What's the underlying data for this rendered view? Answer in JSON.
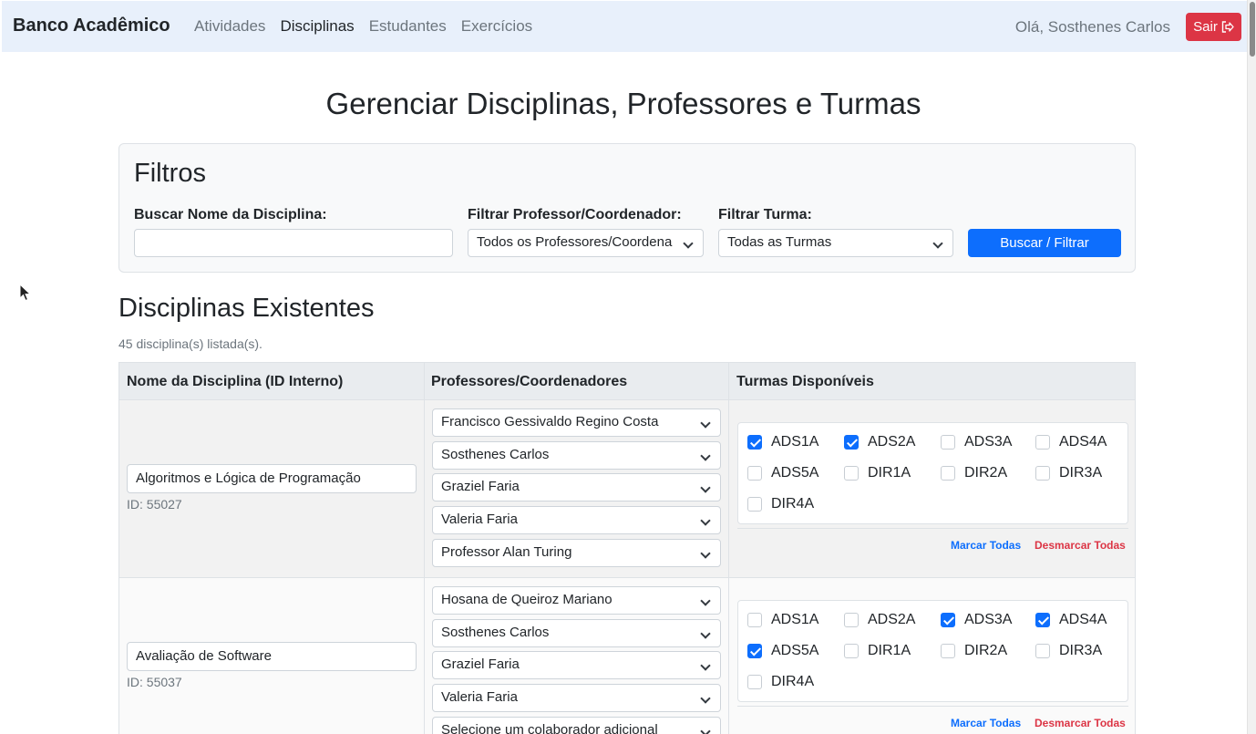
{
  "nav": {
    "brand": "Banco Acadêmico",
    "links": [
      "Atividades",
      "Disciplinas",
      "Estudantes",
      "Exercícios"
    ],
    "greeting": "Olá, Sosthenes Carlos",
    "logout": "Sair"
  },
  "page_title": "Gerenciar Disciplinas, Professores e Turmas",
  "filters": {
    "title": "Filtros",
    "name_label": "Buscar Nome da Disciplina:",
    "name_value": "",
    "prof_label": "Filtrar Professor/Coordenador:",
    "prof_value": "Todos os Professores/Coordena",
    "turma_label": "Filtrar Turma:",
    "turma_value": "Todas as Turmas",
    "search_button": "Buscar / Filtrar"
  },
  "list": {
    "title": "Disciplinas Existentes",
    "count": "45 disciplina(s) listada(s)."
  },
  "table": {
    "headers": [
      "Nome da Disciplina (ID Interno)",
      "Professores/Coordenadores",
      "Turmas Disponíveis"
    ],
    "mark_all": "Marcar Todas",
    "unmark_all": "Desmarcar Todas",
    "rows": [
      {
        "name": "Algoritmos e Lógica de Programação",
        "id": "ID: 55027",
        "professors": [
          "Francisco Gessivaldo Regino Costa",
          "Sosthenes Carlos",
          "Graziel Faria",
          "Valeria Faria",
          "Professor Alan Turing"
        ],
        "turmas": [
          {
            "label": "ADS1A",
            "checked": true
          },
          {
            "label": "ADS2A",
            "checked": true
          },
          {
            "label": "ADS3A",
            "checked": false
          },
          {
            "label": "ADS4A",
            "checked": false
          },
          {
            "label": "ADS5A",
            "checked": false
          },
          {
            "label": "DIR1A",
            "checked": false
          },
          {
            "label": "DIR2A",
            "checked": false
          },
          {
            "label": "DIR3A",
            "checked": false
          },
          {
            "label": "DIR4A",
            "checked": false
          }
        ]
      },
      {
        "name": "Avaliação de Software",
        "id": "ID: 55037",
        "professors": [
          "Hosana de Queiroz Mariano",
          "Sosthenes Carlos",
          "Graziel Faria",
          "Valeria Faria",
          "Selecione um colaborador adicional"
        ],
        "turmas": [
          {
            "label": "ADS1A",
            "checked": false
          },
          {
            "label": "ADS2A",
            "checked": false
          },
          {
            "label": "ADS3A",
            "checked": true
          },
          {
            "label": "ADS4A",
            "checked": true
          },
          {
            "label": "ADS5A",
            "checked": true
          },
          {
            "label": "DIR1A",
            "checked": false
          },
          {
            "label": "DIR2A",
            "checked": false
          },
          {
            "label": "DIR3A",
            "checked": false
          },
          {
            "label": "DIR4A",
            "checked": false
          }
        ]
      }
    ]
  }
}
